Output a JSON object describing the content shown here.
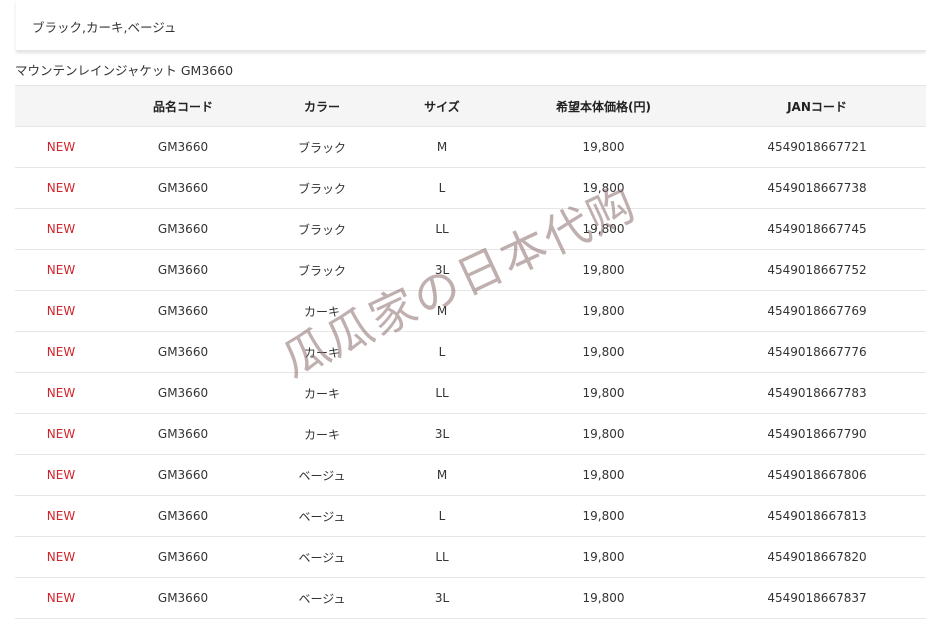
{
  "colors_label": "ブラック,カーキ,ベージュ",
  "product_title": "マウンテンレインジャケット GM3660",
  "table": {
    "headers": [
      "",
      "品名コード",
      "カラー",
      "サイズ",
      "希望本体価格(円)",
      "JANコード"
    ],
    "rows": [
      {
        "badge": "NEW",
        "code": "GM3660",
        "color": "ブラック",
        "size": "M",
        "price": "19,800",
        "jan": "4549018667721"
      },
      {
        "badge": "NEW",
        "code": "GM3660",
        "color": "ブラック",
        "size": "L",
        "price": "19,800",
        "jan": "4549018667738"
      },
      {
        "badge": "NEW",
        "code": "GM3660",
        "color": "ブラック",
        "size": "LL",
        "price": "19,800",
        "jan": "4549018667745"
      },
      {
        "badge": "NEW",
        "code": "GM3660",
        "color": "ブラック",
        "size": "3L",
        "price": "19,800",
        "jan": "4549018667752"
      },
      {
        "badge": "NEW",
        "code": "GM3660",
        "color": "カーキ",
        "size": "M",
        "price": "19,800",
        "jan": "4549018667769"
      },
      {
        "badge": "NEW",
        "code": "GM3660",
        "color": "カーキ",
        "size": "L",
        "price": "19,800",
        "jan": "4549018667776"
      },
      {
        "badge": "NEW",
        "code": "GM3660",
        "color": "カーキ",
        "size": "LL",
        "price": "19,800",
        "jan": "4549018667783"
      },
      {
        "badge": "NEW",
        "code": "GM3660",
        "color": "カーキ",
        "size": "3L",
        "price": "19,800",
        "jan": "4549018667790"
      },
      {
        "badge": "NEW",
        "code": "GM3660",
        "color": "ベージュ",
        "size": "M",
        "price": "19,800",
        "jan": "4549018667806"
      },
      {
        "badge": "NEW",
        "code": "GM3660",
        "color": "ベージュ",
        "size": "L",
        "price": "19,800",
        "jan": "4549018667813"
      },
      {
        "badge": "NEW",
        "code": "GM3660",
        "color": "ベージュ",
        "size": "LL",
        "price": "19,800",
        "jan": "4549018667820"
      },
      {
        "badge": "NEW",
        "code": "GM3660",
        "color": "ベージュ",
        "size": "3L",
        "price": "19,800",
        "jan": "4549018667837"
      }
    ]
  },
  "watermark": "瓜瓜家の日本代购",
  "colors": {
    "badge": "#d2232a",
    "header_bg": "#f5f5f5",
    "border": "#e6e6e6"
  }
}
